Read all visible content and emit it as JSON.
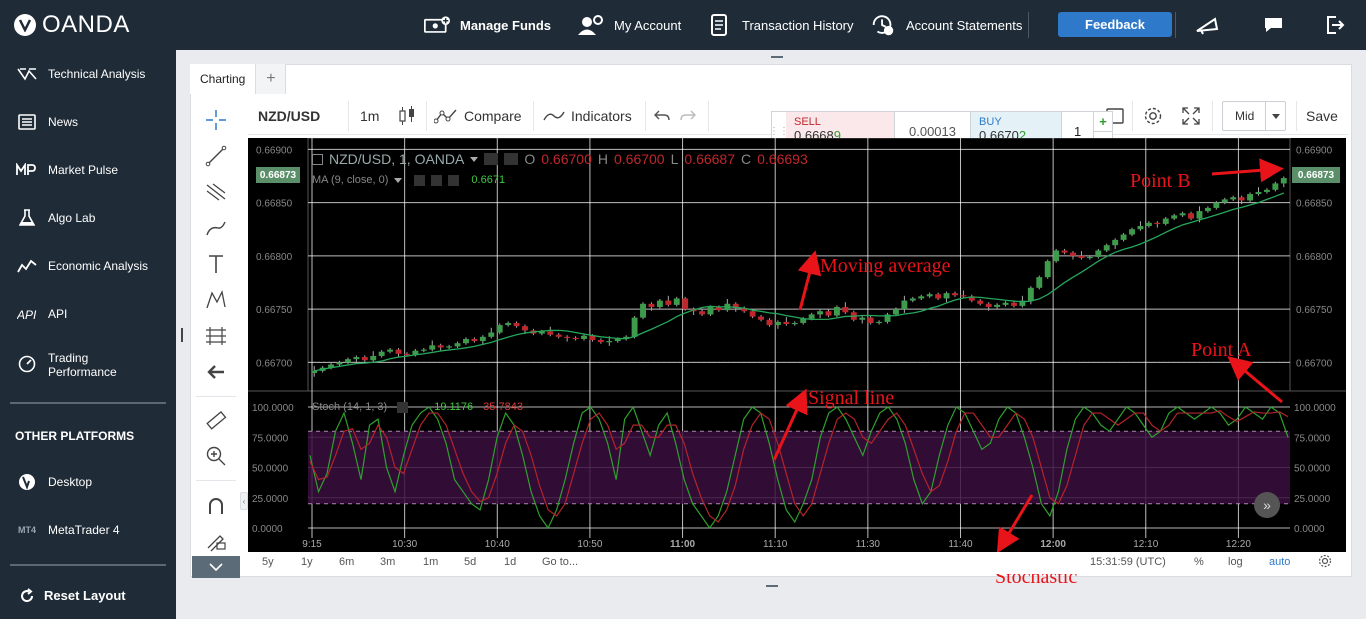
{
  "topbar": {
    "logo_text": "OANDA",
    "nav": [
      {
        "label": "Manage Funds",
        "icon": "manage-funds-icon"
      },
      {
        "label": "My Account",
        "icon": "account-icon"
      },
      {
        "label": "Transaction History",
        "icon": "document-icon"
      },
      {
        "label": "Account Statements",
        "icon": "statement-clock-icon"
      }
    ],
    "feedback_label": "Feedback"
  },
  "sidebar": {
    "items": [
      {
        "label": "Technical Analysis",
        "icon": "technical-analysis-icon"
      },
      {
        "label": "News",
        "icon": "news-icon"
      },
      {
        "label": "Market Pulse",
        "icon": "market-pulse-icon"
      },
      {
        "label": "Algo Lab",
        "icon": "flask-icon"
      },
      {
        "label": "Economic Analysis",
        "icon": "economic-analysis-icon"
      },
      {
        "label": "API",
        "icon": "api-icon"
      },
      {
        "label": "Trading Performance",
        "icon": "speedometer-icon"
      }
    ],
    "other_platforms_title": "OTHER PLATFORMS",
    "platforms": [
      {
        "label": "Desktop",
        "icon": "desktop-logo-icon"
      },
      {
        "label": "MetaTrader 4",
        "icon": "mt4-icon",
        "icon_text": "MT4"
      }
    ],
    "reset_label": "Reset Layout"
  },
  "tabs": {
    "charting": "Charting",
    "add": "+"
  },
  "toolbar": {
    "symbol": "NZD/USD",
    "interval": "1m",
    "compare": "Compare",
    "indicators": "Indicators",
    "price_type": "Mid",
    "save": "Save"
  },
  "trade": {
    "sell_label": "SELL",
    "sell_price_main": "0.6668",
    "sell_price_pip": "9",
    "spread": "0.00013",
    "buy_label": "BUY",
    "buy_price_main": "0.6670",
    "buy_price_pip": "2",
    "quantity": "1",
    "plus": "+",
    "minus": "−"
  },
  "chart_header": {
    "title": "NZD/USD, 1, OANDA",
    "open_label": "O",
    "open": "0.66700",
    "high_label": "H",
    "high": "0.66700",
    "low_label": "L",
    "low": "0.66687",
    "close_label": "C",
    "close": "0.66693",
    "ma_label": "MA (9, close, 0)",
    "ma_value": "0.6671",
    "stoch_label": "Stoch (14, 1, 3)",
    "stoch_k": "19.1176",
    "stoch_d": "35.7843",
    "last_price_tag": "0.66873"
  },
  "annotations": {
    "point_b": "Point B",
    "moving_average": "Moving average",
    "point_a": "Point A",
    "signal_line": "Signal line",
    "stochastic": "Stochastic"
  },
  "bottom_bar": {
    "ranges": [
      "5y",
      "1y",
      "6m",
      "3m",
      "1m",
      "5d",
      "1d"
    ],
    "goto": "Go to...",
    "time": "15:31:59 (UTC)",
    "percent": "%",
    "log": "log",
    "auto": "auto"
  },
  "colors": {
    "bull": "#3f9b4c",
    "bear": "#c0272d",
    "ma": "#26a65b",
    "stoch_k": "#2ea02e",
    "stoch_d": "#b3232b",
    "accent": "#2e79c9",
    "annotation": "#e8141a"
  },
  "chart_data": [
    {
      "type": "candlestick",
      "title": "NZD/USD, 1, OANDA",
      "x_ticks": [
        "9:15",
        "10:30",
        "10:40",
        "10:50",
        "11:00",
        "11:10",
        "11:30",
        "11:40",
        "12:00",
        "12:10",
        "12:20"
      ],
      "ylim": [
        0.66675,
        0.66905
      ],
      "y_ticks": [
        "0.66900",
        "0.66850",
        "0.66800",
        "0.66750",
        "0.66700"
      ],
      "close_series": [
        0.66692,
        0.66695,
        0.66698,
        0.667,
        0.66703,
        0.66705,
        0.66702,
        0.66706,
        0.6671,
        0.66712,
        0.66708,
        0.66707,
        0.66711,
        0.66712,
        0.66716,
        0.66714,
        0.66715,
        0.66718,
        0.66722,
        0.6672,
        0.66724,
        0.66728,
        0.66735,
        0.66737,
        0.66734,
        0.6673,
        0.66727,
        0.66729,
        0.66726,
        0.66724,
        0.66723,
        0.66722,
        0.66725,
        0.66721,
        0.66719,
        0.6672,
        0.66722,
        0.66724,
        0.66742,
        0.66755,
        0.66752,
        0.66758,
        0.66754,
        0.6676,
        0.6675,
        0.66748,
        0.66745,
        0.66752,
        0.66749,
        0.66755,
        0.66751,
        0.66748,
        0.66743,
        0.6674,
        0.66735,
        0.66738,
        0.66736,
        0.66737,
        0.66741,
        0.66745,
        0.66748,
        0.66744,
        0.66752,
        0.66747,
        0.6674,
        0.66742,
        0.66737,
        0.66738,
        0.66745,
        0.6675,
        0.66758,
        0.6676,
        0.66762,
        0.66764,
        0.6676,
        0.66765,
        0.66763,
        0.66762,
        0.66758,
        0.66755,
        0.66752,
        0.66754,
        0.66756,
        0.66753,
        0.66758,
        0.6677,
        0.6678,
        0.66795,
        0.66805,
        0.66803,
        0.668,
        0.66798,
        0.66799,
        0.66805,
        0.6681,
        0.66815,
        0.6682,
        0.66825,
        0.66828,
        0.66831,
        0.6683,
        0.66835,
        0.66838,
        0.6684,
        0.66835,
        0.66842,
        0.66845,
        0.6685,
        0.66853,
        0.66855,
        0.66852,
        0.66858,
        0.6686,
        0.66862,
        0.66868,
        0.66873
      ],
      "ma_period": 9,
      "ma_last": 0.6671
    },
    {
      "type": "line",
      "title": "Stoch (14, 1, 3)",
      "ylim": [
        0,
        100
      ],
      "y_ticks": [
        "100.0000",
        "75.0000",
        "50.0000",
        "25.0000",
        "0.0000"
      ],
      "bands": [
        20,
        80
      ],
      "series": [
        {
          "name": "%K",
          "values": [
            60,
            30,
            45,
            80,
            95,
            70,
            40,
            85,
            90,
            50,
            30,
            60,
            85,
            95,
            100,
            90,
            70,
            40,
            30,
            20,
            15,
            40,
            75,
            95,
            85,
            60,
            30,
            10,
            0,
            15,
            40,
            70,
            95,
            100,
            90,
            70,
            40,
            90,
            100,
            80,
            60,
            85,
            95,
            70,
            40,
            20,
            10,
            0,
            10,
            30,
            60,
            90,
            100,
            95,
            70,
            40,
            15,
            5,
            20,
            40,
            75,
            95,
            100,
            90,
            75,
            60,
            80,
            95,
            100,
            90,
            70,
            40,
            20,
            30,
            60,
            85,
            100,
            95,
            80,
            65,
            70,
            90,
            100,
            95,
            75,
            50,
            20,
            10,
            30,
            65,
            90,
            100,
            95,
            85,
            80,
            90,
            100,
            95,
            85,
            75,
            80,
            95,
            100,
            95,
            90,
            95,
            100,
            95,
            85,
            90,
            100,
            95,
            90,
            100,
            95,
            75
          ]
        },
        {
          "name": "%D",
          "values": [
            55,
            40,
            42,
            60,
            80,
            82,
            65,
            70,
            85,
            75,
            50,
            45,
            65,
            85,
            95,
            95,
            85,
            65,
            45,
            30,
            22,
            25,
            45,
            70,
            85,
            80,
            60,
            35,
            15,
            10,
            20,
            45,
            70,
            90,
            95,
            85,
            65,
            70,
            85,
            85,
            75,
            75,
            85,
            85,
            70,
            45,
            25,
            10,
            5,
            15,
            35,
            65,
            85,
            95,
            90,
            70,
            45,
            20,
            10,
            20,
            45,
            70,
            90,
            95,
            90,
            75,
            70,
            80,
            90,
            95,
            85,
            65,
            45,
            30,
            35,
            55,
            80,
            95,
            95,
            85,
            75,
            75,
            85,
            95,
            90,
            75,
            50,
            25,
            20,
            35,
            60,
            85,
            95,
            95,
            90,
            85,
            90,
            95,
            95,
            85,
            80,
            85,
            95,
            95,
            95,
            95,
            95,
            97,
            92,
            88,
            92,
            96,
            95,
            95,
            96,
            92
          ]
        }
      ]
    }
  ]
}
